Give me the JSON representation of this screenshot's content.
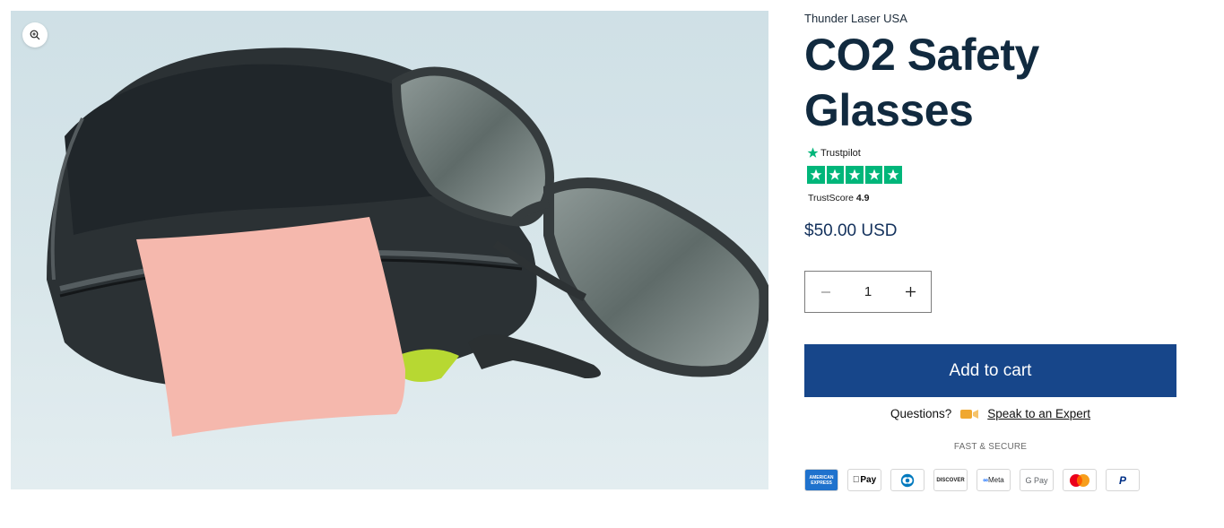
{
  "product": {
    "vendor": "Thunder Laser USA",
    "title": "CO2 Safety Glasses",
    "price": "$50.00 USD"
  },
  "trustpilot": {
    "brand": "Trustpilot",
    "stars": 5,
    "score_label": "TrustScore",
    "score_value": "4.9",
    "color": "#00b67a"
  },
  "quantity": {
    "value": "1",
    "decrease_icon": "minus-icon",
    "increase_icon": "plus-icon"
  },
  "cart": {
    "add_label": "Add to cart",
    "color": "#17468a"
  },
  "help": {
    "question": "Questions?",
    "icon": "video-camera-icon",
    "link": "Speak to an Expert"
  },
  "secure_label": "FAST & SECURE",
  "payment_methods": [
    {
      "name": "amex-icon",
      "label": "AMERICAN EXPRESS"
    },
    {
      "name": "apple-pay-icon",
      "label": "Pay"
    },
    {
      "name": "diners-club-icon",
      "label": ""
    },
    {
      "name": "discover-icon",
      "label": "DISCOVER"
    },
    {
      "name": "meta-pay-icon",
      "label": "Meta"
    },
    {
      "name": "google-pay-icon",
      "label": "G Pay"
    },
    {
      "name": "mastercard-icon",
      "label": ""
    },
    {
      "name": "paypal-icon",
      "label": "P"
    }
  ],
  "media": {
    "zoom_icon": "zoom-in-icon",
    "image": "safety-glasses-with-case-and-cloth"
  }
}
